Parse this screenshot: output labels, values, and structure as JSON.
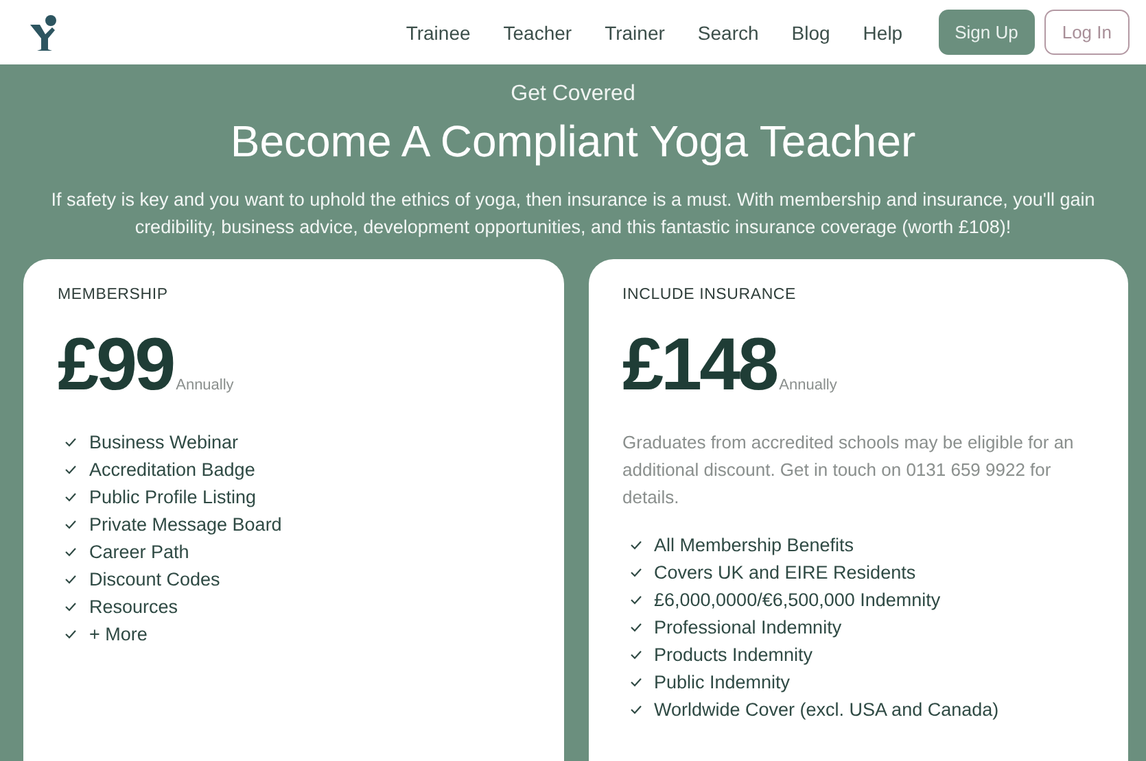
{
  "nav": {
    "links": [
      "Trainee",
      "Teacher",
      "Trainer",
      "Search",
      "Blog",
      "Help"
    ],
    "signup": "Sign Up",
    "login": "Log In"
  },
  "hero": {
    "eyebrow": "Get Covered",
    "title": "Become A Compliant Yoga Teacher",
    "text": "If safety is key and you want to uphold the ethics of yoga, then insurance is a must. With membership and insurance, you'll gain credibility, business advice, development opportunities, and this fantastic insurance coverage (worth £108)!"
  },
  "plans": [
    {
      "label": "MEMBERSHIP",
      "price": "£99",
      "period": "Annually",
      "features": [
        "Business Webinar",
        "Accreditation Badge",
        "Public Profile Listing",
        "Private Message Board",
        "Career Path",
        "Discount Codes",
        "Resources",
        "+ More"
      ]
    },
    {
      "label": "INCLUDE INSURANCE",
      "price": "£148",
      "period": "Annually",
      "note": "Graduates from accredited schools may be eligible for an additional discount. Get in touch on 0131 659 9922 for details.",
      "features": [
        "All Membership Benefits",
        "Covers UK and EIRE Residents",
        "£6,000,0000/€6,500,000 Indemnity",
        "Professional Indemnity",
        "Products Indemnity",
        "Public Indemnity",
        "Worldwide Cover (excl. USA and Canada)"
      ]
    }
  ]
}
